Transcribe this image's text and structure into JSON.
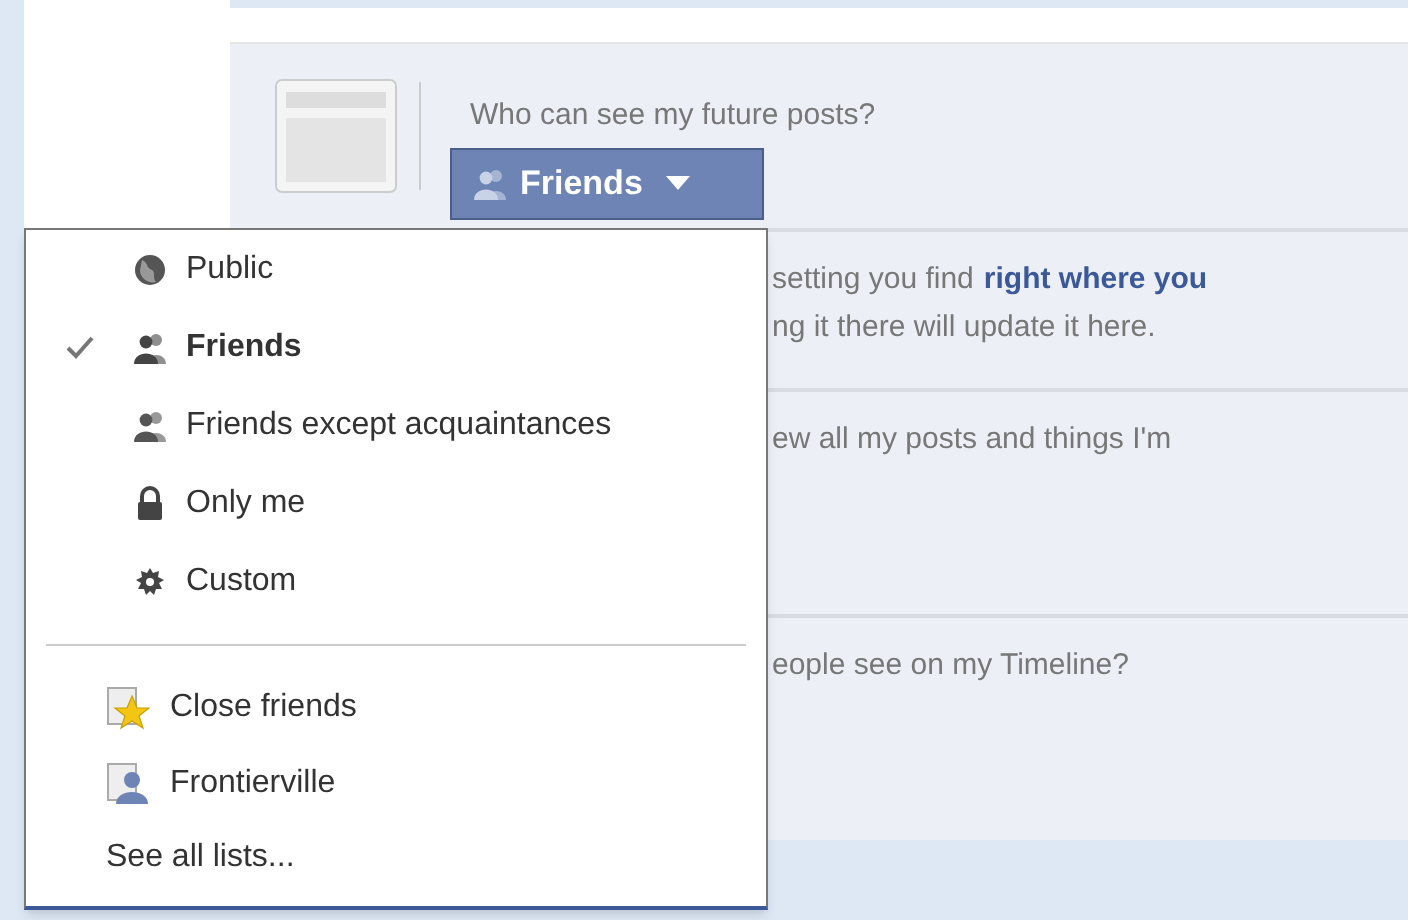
{
  "setting": {
    "question": "Who can see my future posts?",
    "button_label": "Friends"
  },
  "rows": [
    {
      "lines": [
        [
          {
            "text": "setting you find",
            "link": false
          },
          {
            "text": "right where you",
            "link": true
          }
        ],
        [
          {
            "text": "ng it there will update it here.",
            "link": false
          }
        ]
      ]
    },
    {
      "lines": [
        [
          {
            "text": "ew all my posts and things I'm",
            "link": false
          }
        ]
      ]
    },
    {
      "lines": [
        [
          {
            "text": "eople see on my Timeline?",
            "link": false
          }
        ]
      ]
    }
  ],
  "menu": {
    "options": [
      {
        "label": "Public",
        "kind": "public",
        "selected": false
      },
      {
        "label": "Friends",
        "kind": "friends",
        "selected": true
      },
      {
        "label": "Friends except acquaintances",
        "kind": "except",
        "selected": false
      },
      {
        "label": "Only me",
        "kind": "lock",
        "selected": false
      },
      {
        "label": "Custom",
        "kind": "custom",
        "selected": false
      }
    ],
    "lists": [
      {
        "label": "Close friends",
        "kind": "star"
      },
      {
        "label": "Frontierville",
        "kind": "person"
      }
    ],
    "more": "See all lists..."
  }
}
